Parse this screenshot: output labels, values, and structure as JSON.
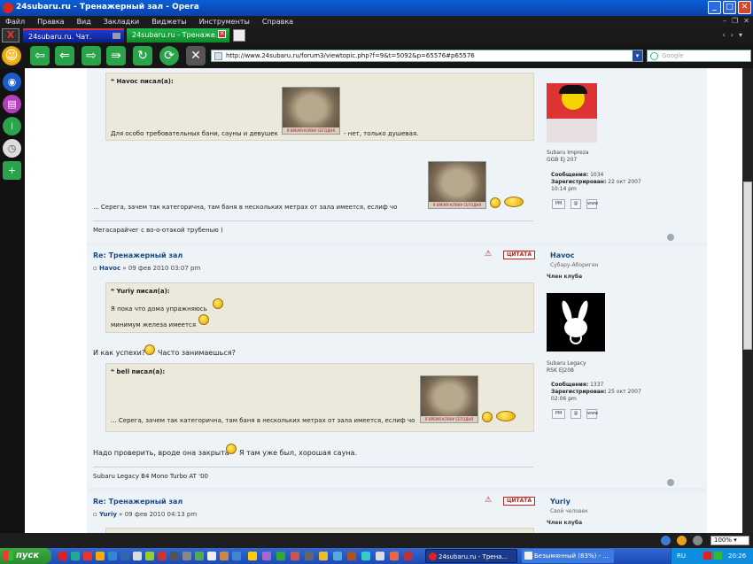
{
  "window": {
    "title": "24subaru.ru - Тренажерный зал - Opera",
    "controls": [
      "_",
      "□",
      "✕"
    ]
  },
  "menu": [
    "Файл",
    "Правка",
    "Вид",
    "Закладки",
    "Виджеты",
    "Инструменты",
    "Справка"
  ],
  "tabs": [
    {
      "label": "24subaru.ru. Чат."
    },
    {
      "label": "24subaru.ru - Тренаже..."
    }
  ],
  "address": {
    "url": "http://www.24subaru.ru/forum3/viewtopic.php?f=9&t=5092&p=65576#p65576"
  },
  "search": {
    "placeholder": "Google"
  },
  "post1": {
    "quote_author": "Havoc писал(а):",
    "quote_text_before": "Для особо требовательных бани, сауны и девушек",
    "quote_text_after": "- нет, только душевая.",
    "body_text": "... Серега, зачем так категорична, там баня в нескольких метрах от зала имеется, еслиф чо",
    "signature": "Мегасарайчег с во-о-отакой трубенью )",
    "author": {
      "car": "Subaru Impreza",
      "engine": "GGB EJ 207",
      "posts_label": "Сообщения:",
      "posts": "1034",
      "registered_label": "Зарегистрирован:",
      "registered": "22 окт 2007",
      "registered_time": "10:14 pm"
    }
  },
  "post2": {
    "title": "Re: Тренажерный зал",
    "author": "Havoc",
    "date": "» 09 фев 2010 03:07 pm",
    "quote_btn": "ЦИТАТА",
    "quote1_author": "Yuriy писал(а):",
    "quote1_line1": "Я пока что дома упражняюсь",
    "quote1_line2": "минимум железа имеется",
    "text1a": "И как успехи?",
    "text1b": "Часто занимаешься?",
    "quote2_author": "bell писал(а):",
    "quote2_text": "... Серега, зачем так категорична, там баня в нескольких метрах от зала имеется, еслиф чо",
    "text2a": "Надо проверить, вроде она закрыта",
    "text2b": "Я там уже был, хорошая сауна.",
    "signature": "Subaru Legacy B4 Mono Turbo AT '00",
    "profile": {
      "name": "Havoc",
      "rank": "Субару-Абориген",
      "rank2": "Член клуба",
      "car": "Subaru Legacy",
      "engine": "RSK EJ208",
      "posts_label": "Сообщения:",
      "posts": "1337",
      "registered_label": "Зарегистрирован:",
      "registered": "25 окт 2007",
      "registered_time": "02:06 pm"
    }
  },
  "post3": {
    "title": "Re: Тренажерный зал",
    "author": "Yuriy",
    "date": "» 09 фев 2010 04:13 pm",
    "quote_btn": "ЦИТАТА",
    "profile": {
      "name": "Yuriy",
      "rank": "Свой человек",
      "rank2": "Член клуба"
    }
  },
  "image_caption": "Я ВРЕМЯ КЛЯНУ СЕГОДНЯ",
  "profile_btns": {
    "pm": "PM",
    "email": "@",
    "www": "www"
  },
  "status": {
    "zoom": "100%"
  },
  "taskbar": {
    "start": "пуск",
    "tasks": [
      {
        "label": "24subaru.ru - Трена..."
      },
      {
        "label": "Безымянный (83%) - ..."
      }
    ],
    "lang": "RU",
    "clock": "20:26"
  },
  "colors": {
    "titlebar": "#0a5fd6",
    "link": "#1a4a82",
    "quote_bg": "#ebe8dc",
    "post_bg": "#eef3f8"
  }
}
